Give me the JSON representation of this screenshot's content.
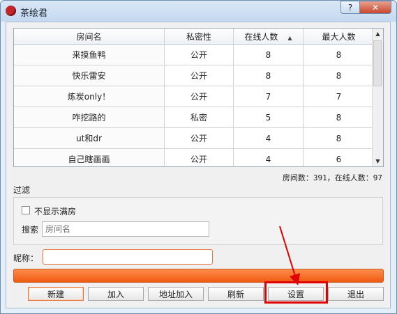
{
  "window": {
    "title": "茶绘君",
    "help_label": "?",
    "close_label": "✕",
    "icon": "teapot-app-icon"
  },
  "room_table": {
    "columns": [
      "房间名",
      "私密性",
      "在线人数",
      "最大人数"
    ],
    "sort_icon": "▲",
    "rows": [
      [
        "来摸鱼鸭",
        "公开",
        "8",
        "8"
      ],
      [
        "快乐雷安",
        "公开",
        "8",
        "8"
      ],
      [
        "炼炭only！",
        "公开",
        "7",
        "7"
      ],
      [
        "咋挖路的",
        "私密",
        "5",
        "8"
      ],
      [
        "ut和dr",
        "公开",
        "4",
        "8"
      ],
      [
        "自己瞎画画",
        "公开",
        "4",
        "6"
      ]
    ]
  },
  "status_text": "房间数：391，在线人数：97",
  "filter": {
    "label": "过滤",
    "hide_full_label": "不显示满房",
    "hide_full_checked": false,
    "search_label": "搜索",
    "search_placeholder": "房间名",
    "search_value": ""
  },
  "nickname": {
    "label": "昵称：",
    "value": ""
  },
  "buttons": {
    "new": "新建",
    "join": "加入",
    "address_join": "地址加入",
    "refresh": "刷新",
    "settings": "设置",
    "exit": "退出"
  },
  "colors": {
    "accent_orange": "#f26a22",
    "highlight_red": "#e00000"
  }
}
